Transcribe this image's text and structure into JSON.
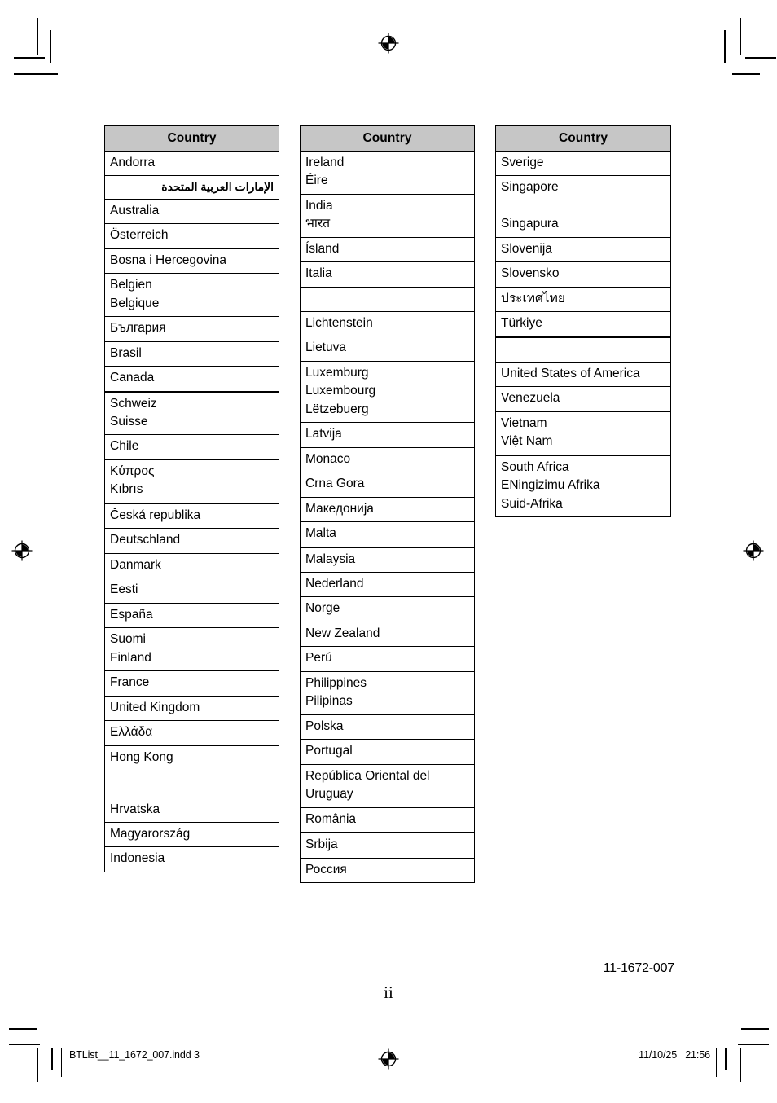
{
  "page": {
    "folio": "ii",
    "doc_code": "11-1672-007",
    "slug_filename": "BTList__11_1672_007.indd   3",
    "slug_datetime": "11/10/25   21:56"
  },
  "marks": {
    "registration_top": "registration-mark",
    "registration_left": "registration-mark",
    "registration_right": "registration-mark",
    "registration_bottom": "registration-mark"
  },
  "tables": [
    {
      "id": "table-col-1",
      "header": "Country",
      "rows": [
        {
          "text": "Andorra",
          "rtl": false,
          "thick_top": false
        },
        {
          "text": "الإمارات العربية المتحدة",
          "rtl": true,
          "thick_top": false
        },
        {
          "text": "Australia",
          "rtl": false,
          "thick_top": false
        },
        {
          "text": "Österreich",
          "rtl": false,
          "thick_top": false
        },
        {
          "text": "Bosna i Hercegovina",
          "rtl": false,
          "thick_top": false
        },
        {
          "text": "Belgien\nBelgique",
          "rtl": false,
          "thick_top": false
        },
        {
          "text": "България",
          "rtl": false,
          "thick_top": false
        },
        {
          "text": "Brasil",
          "rtl": false,
          "thick_top": false
        },
        {
          "text": "Canada",
          "rtl": false,
          "thick_top": false
        },
        {
          "text": "Schweiz\nSuisse",
          "rtl": false,
          "thick_top": true
        },
        {
          "text": "Chile",
          "rtl": false,
          "thick_top": false
        },
        {
          "text": "Κύπρος\nKıbrıs",
          "rtl": false,
          "thick_top": false
        },
        {
          "text": "Česká republika",
          "rtl": false,
          "thick_top": true
        },
        {
          "text": "Deutschland",
          "rtl": false,
          "thick_top": false
        },
        {
          "text": "Danmark",
          "rtl": false,
          "thick_top": false
        },
        {
          "text": "Eesti",
          "rtl": false,
          "thick_top": false
        },
        {
          "text": "España",
          "rtl": false,
          "thick_top": false
        },
        {
          "text": "Suomi\nFinland",
          "rtl": false,
          "thick_top": false
        },
        {
          "text": "France",
          "rtl": false,
          "thick_top": false
        },
        {
          "text": "United Kingdom",
          "rtl": false,
          "thick_top": false
        },
        {
          "text": "Ελλάδα",
          "rtl": false,
          "thick_top": false
        },
        {
          "text": "Hong Kong",
          "rtl": false,
          "thick_top": false,
          "tall": true
        },
        {
          "text": "Hrvatska",
          "rtl": false,
          "thick_top": false
        },
        {
          "text": "Magyarország",
          "rtl": false,
          "thick_top": false
        },
        {
          "text": "Indonesia",
          "rtl": false,
          "thick_top": false
        }
      ]
    },
    {
      "id": "table-col-2",
      "header": "Country",
      "rows": [
        {
          "text": "Ireland\nÉire",
          "rtl": false,
          "thick_top": false
        },
        {
          "text": "India\nभारत",
          "rtl": false,
          "thick_top": false
        },
        {
          "text": "Ísland",
          "rtl": false,
          "thick_top": false
        },
        {
          "text": "Italia",
          "rtl": false,
          "thick_top": false
        },
        {
          "text": "",
          "rtl": false,
          "thick_top": false,
          "blank": true
        },
        {
          "text": "Lichtenstein",
          "rtl": false,
          "thick_top": false
        },
        {
          "text": "Lietuva",
          "rtl": false,
          "thick_top": false
        },
        {
          "text": "Luxemburg\nLuxembourg\nLëtzebuerg",
          "rtl": false,
          "thick_top": false
        },
        {
          "text": "Latvija",
          "rtl": false,
          "thick_top": false
        },
        {
          "text": "Monaco",
          "rtl": false,
          "thick_top": false
        },
        {
          "text": "Crna Gora",
          "rtl": false,
          "thick_top": false
        },
        {
          "text": "Македонија",
          "rtl": false,
          "thick_top": false
        },
        {
          "text": "Malta",
          "rtl": false,
          "thick_top": false
        },
        {
          "text": "Malaysia",
          "rtl": false,
          "thick_top": true
        },
        {
          "text": "Nederland",
          "rtl": false,
          "thick_top": false
        },
        {
          "text": "Norge",
          "rtl": false,
          "thick_top": false
        },
        {
          "text": "New Zealand",
          "rtl": false,
          "thick_top": false
        },
        {
          "text": "Perú",
          "rtl": false,
          "thick_top": false
        },
        {
          "text": "Philippines\nPilipinas",
          "rtl": false,
          "thick_top": false
        },
        {
          "text": "Polska",
          "rtl": false,
          "thick_top": false
        },
        {
          "text": "Portugal",
          "rtl": false,
          "thick_top": false
        },
        {
          "text": "República Oriental del\nUruguay",
          "rtl": false,
          "thick_top": false
        },
        {
          "text": "România",
          "rtl": false,
          "thick_top": false
        },
        {
          "text": "Srbija",
          "rtl": false,
          "thick_top": true
        },
        {
          "text": "Россия",
          "rtl": false,
          "thick_top": false
        }
      ]
    },
    {
      "id": "table-col-3",
      "header": "Country",
      "rows": [
        {
          "text": "Sverige",
          "rtl": false,
          "thick_top": false
        },
        {
          "text": "Singapore\n\nSingapura",
          "rtl": false,
          "thick_top": false
        },
        {
          "text": "Slovenija",
          "rtl": false,
          "thick_top": false
        },
        {
          "text": "Slovensko",
          "rtl": false,
          "thick_top": false
        },
        {
          "text": "ประเทศไทย",
          "rtl": false,
          "thick_top": false
        },
        {
          "text": "Türkiye",
          "rtl": false,
          "thick_top": false
        },
        {
          "text": "",
          "rtl": false,
          "thick_top": true,
          "blank": true
        },
        {
          "text": "United States of America",
          "rtl": false,
          "thick_top": false
        },
        {
          "text": "Venezuela",
          "rtl": false,
          "thick_top": false
        },
        {
          "text": "Vietnam\nViệt Nam",
          "rtl": false,
          "thick_top": false
        },
        {
          "text": "South Africa\nENingizimu Afrika\nSuid-Afrika",
          "rtl": false,
          "thick_top": true
        }
      ]
    }
  ]
}
